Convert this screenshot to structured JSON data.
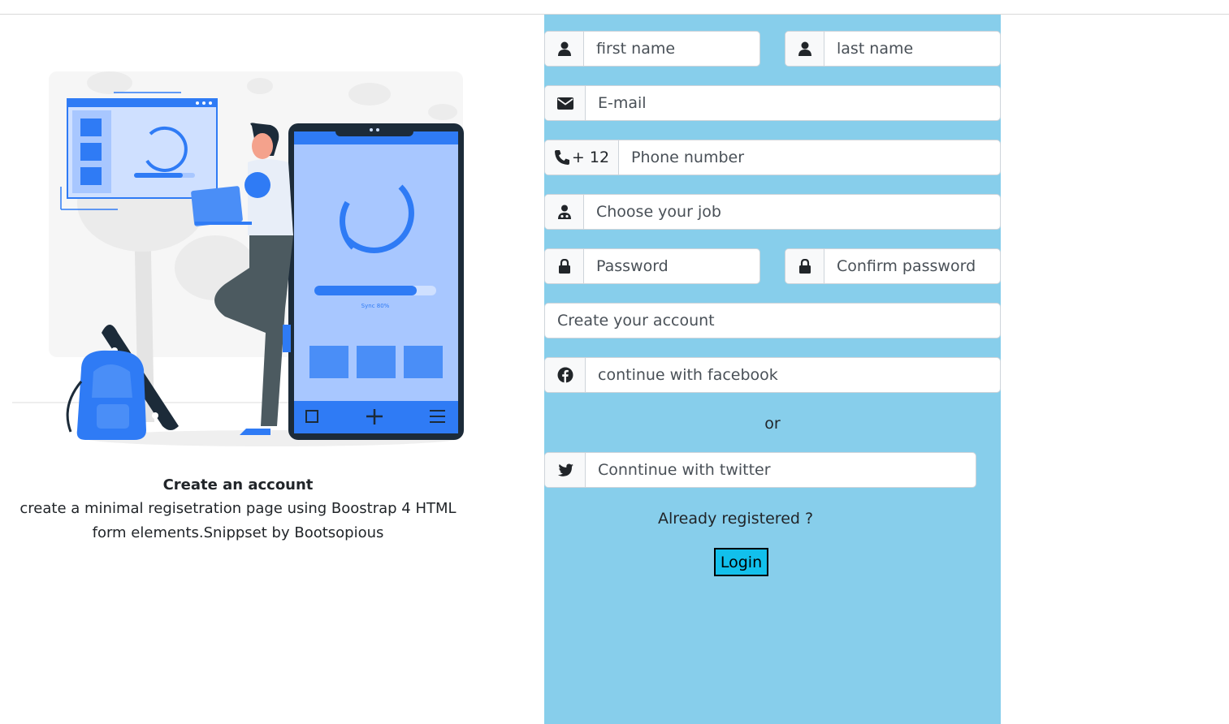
{
  "intro": {
    "title": "Create an account",
    "description": "create a minimal regisetration page using Boostrap 4 HTML form elements.Snippset by Bootsopious",
    "illustration_sync_text": "Sync 80%"
  },
  "form": {
    "first_name_placeholder": "first name",
    "last_name_placeholder": "last name",
    "email_placeholder": "E-mail",
    "phone_code": "+ 12",
    "phone_placeholder": "Phone number",
    "job_placeholder": "Choose your job",
    "password_placeholder": "Password",
    "confirm_password_placeholder": "Confirm password",
    "create_account_label": "Create your account",
    "facebook_label": "continue with facebook",
    "or_text": "or",
    "twitter_label": "Conntinue with twitter",
    "already_registered": "Already registered ?",
    "login_label": "Login"
  },
  "colors": {
    "panel_bg": "#87ceeb",
    "login_bg": "#12c0ec",
    "accent_blue": "#2f7bf5"
  }
}
